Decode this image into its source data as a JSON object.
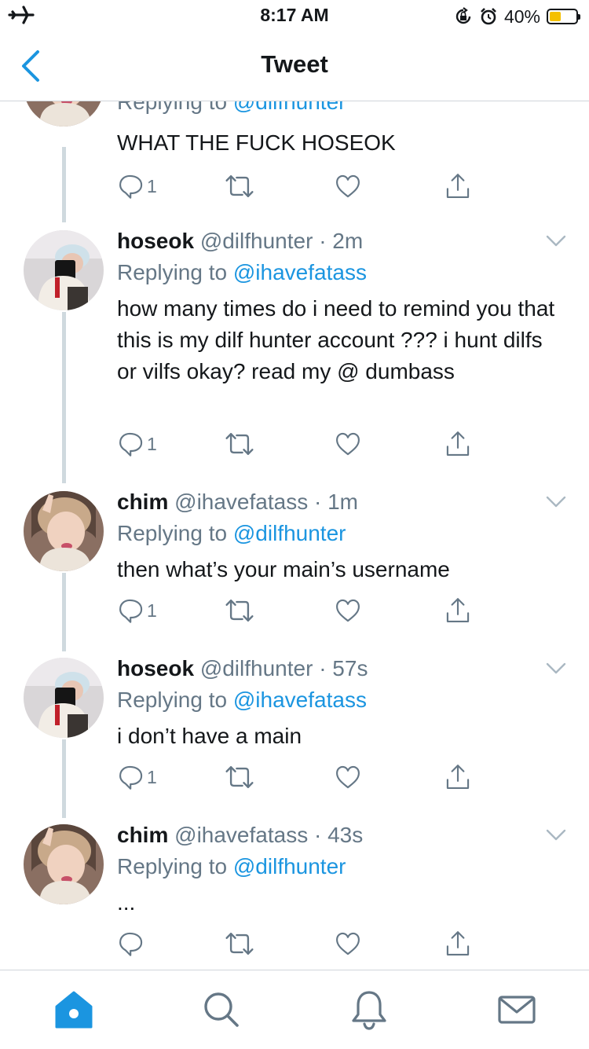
{
  "status_bar": {
    "time": "8:17 AM",
    "battery": "40%",
    "battery_level": 0.4
  },
  "nav": {
    "title": "Tweet"
  },
  "colors": {
    "accent": "#1b95e0",
    "secondary_text": "#657786",
    "divider": "#cfd9de"
  },
  "tweets": [
    {
      "name": "",
      "handle": "",
      "time": "",
      "replying_prefix": "Replying to",
      "replying_to": "@dilfhunter",
      "text": "WHAT THE FUCK HOSEOK",
      "reply_count": "1"
    },
    {
      "name": "hoseok",
      "handle": "@dilfhunter",
      "time": "· 2m",
      "replying_prefix": "Replying to",
      "replying_to": "@ihavefatass",
      "text": "how many times do i need to remind you that this is my dilf hunter account ??? i hunt dilfs or vilfs okay? read my @ dumbass",
      "reply_count": "1"
    },
    {
      "name": "chim",
      "handle": "@ihavefatass",
      "time": "· 1m",
      "replying_prefix": "Replying to",
      "replying_to": "@dilfhunter",
      "text": "then what’s your main’s username",
      "reply_count": "1"
    },
    {
      "name": "hoseok",
      "handle": "@dilfhunter",
      "time": "· 57s",
      "replying_prefix": "Replying to",
      "replying_to": "@ihavefatass",
      "text": "i don’t have a main",
      "reply_count": "1"
    },
    {
      "name": "chim",
      "handle": "@ihavefatass",
      "time": "· 43s",
      "replying_prefix": "Replying to",
      "replying_to": "@dilfhunter",
      "text": "...",
      "reply_count": ""
    }
  ]
}
